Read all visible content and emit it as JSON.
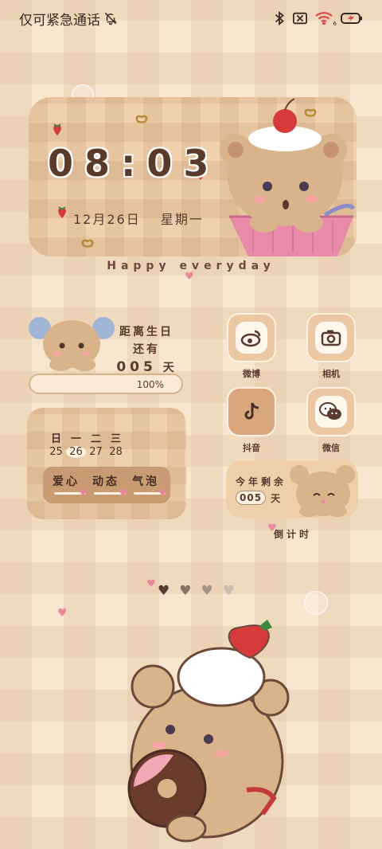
{
  "status_bar": {
    "left_text": "仅可紧急通话",
    "icons": [
      "bell-off-icon",
      "bluetooth-icon",
      "no-sim-icon",
      "wifi-icon",
      "battery-charging-icon"
    ],
    "wifi_badge": "6",
    "colors": {
      "wifi": "#e04a4a",
      "battery": "#3a2a22"
    }
  },
  "clock_widget": {
    "time": "08:03",
    "date": "12月26日",
    "weekday": "星期一"
  },
  "tagline": "Happy everyday",
  "birthday_widget": {
    "line1": "距离生日",
    "line2": "还有",
    "days": "005",
    "days_unit": "天",
    "progress_label": "100%",
    "progress_value": 1.0
  },
  "calendar_widget": {
    "weekdays": [
      "日",
      "一",
      "二",
      "三"
    ],
    "dates": [
      "25",
      "26",
      "27",
      "28"
    ],
    "today": "26",
    "items": [
      "爱心",
      "动态",
      "气泡"
    ]
  },
  "apps": [
    {
      "label": "微博",
      "icon": "weibo-icon"
    },
    {
      "label": "相机",
      "icon": "camera-icon"
    },
    {
      "label": "抖音",
      "icon": "tiktok-icon"
    },
    {
      "label": "微信",
      "icon": "wechat-icon"
    }
  ],
  "countdown_widget": {
    "line1": "今年剩余",
    "days": "005",
    "unit": "天",
    "caption": "倒计时"
  },
  "page_indicator": {
    "count": 4,
    "current": 0
  },
  "theme": {
    "accent": "#5b3a2e",
    "background": "#f8e6cf",
    "pink": "#e9879c"
  }
}
